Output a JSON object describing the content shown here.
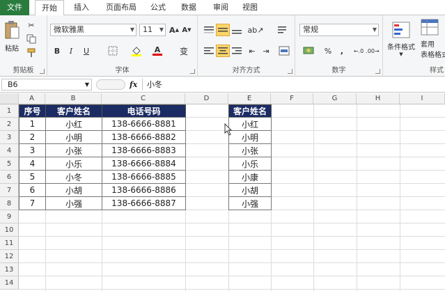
{
  "tabs": [
    "文件",
    "开始",
    "插入",
    "页面布局",
    "公式",
    "数据",
    "审阅",
    "视图"
  ],
  "ribbon": {
    "clipboard": {
      "label": "剪贴板",
      "paste": "粘贴"
    },
    "font": {
      "label": "字体",
      "name": "微软雅黑",
      "size": "11",
      "grow": "A",
      "shrink": "A",
      "bold": "B",
      "italic": "I",
      "underline": "U",
      "font_color": "A",
      "wen": "变"
    },
    "align": {
      "label": "对齐方式"
    },
    "number": {
      "label": "数字",
      "format": "常规",
      "percent": "%",
      "comma": ","
    },
    "styles": {
      "label": "样式",
      "conditional": "条件格式",
      "table_line1": "套用",
      "table_line2": "表格格式"
    }
  },
  "formula_bar": {
    "name_box": "B6",
    "fx": "fx",
    "content": "小冬"
  },
  "columns": [
    "A",
    "B",
    "C",
    "D",
    "E",
    "F",
    "G",
    "H",
    "I"
  ],
  "rows": [
    "1",
    "2",
    "3",
    "4",
    "5",
    "6",
    "7",
    "8",
    "9",
    "10",
    "11",
    "12",
    "13",
    "14"
  ],
  "table": {
    "headers": [
      "序号",
      "客户姓名",
      "电话号码"
    ],
    "rows": [
      [
        "1",
        "小红",
        "138-6666-8881"
      ],
      [
        "2",
        "小明",
        "138-6666-8882"
      ],
      [
        "3",
        "小张",
        "138-6666-8883"
      ],
      [
        "4",
        "小乐",
        "138-6666-8884"
      ],
      [
        "5",
        "小冬",
        "138-6666-8885"
      ],
      [
        "6",
        "小胡",
        "138-6666-8886"
      ],
      [
        "7",
        "小强",
        "138-6666-8887"
      ]
    ]
  },
  "list": {
    "header": "客户姓名",
    "items": [
      "小红",
      "小明",
      "小张",
      "小乐",
      "小康",
      "小胡",
      "小强"
    ]
  }
}
